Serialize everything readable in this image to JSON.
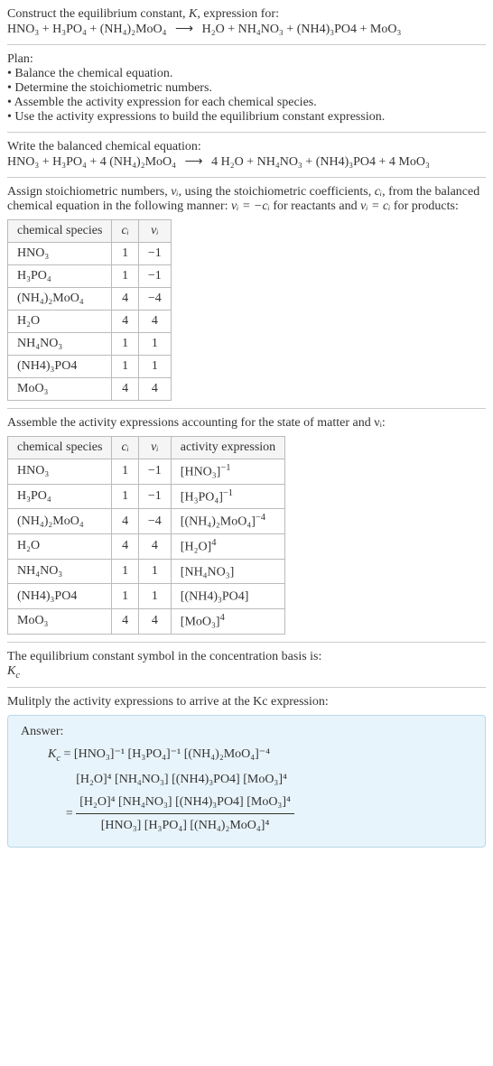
{
  "intro": {
    "line1": "Construct the equilibrium constant, ",
    "kvar": "K",
    "line1b": ", expression for:",
    "eq_lhs": "HNO₃ + H₃PO₄ + (NH₄)₂MoO₄",
    "arrow": "⟶",
    "eq_rhs": "H₂O + NH₄NO₃ + (NH4)₃PO4 + MoO₃"
  },
  "plan": {
    "heading": "Plan:",
    "items": [
      "Balance the chemical equation.",
      "Determine the stoichiometric numbers.",
      "Assemble the activity expression for each chemical species.",
      "Use the activity expressions to build the equilibrium constant expression."
    ]
  },
  "balanced": {
    "heading": "Write the balanced chemical equation:",
    "lhs": "HNO₃ + H₃PO₄ + 4 (NH₄)₂MoO₄",
    "arrow": "⟶",
    "rhs": "4 H₂O + NH₄NO₃ + (NH4)₃PO4 + 4 MoO₃"
  },
  "stoich": {
    "text1": "Assign stoichiometric numbers, ",
    "nu": "νᵢ",
    "text2": ", using the stoichiometric coefficients, ",
    "ci": "cᵢ",
    "text3": ", from the balanced chemical equation in the following manner: ",
    "rel1": "νᵢ = −cᵢ",
    "text4": " for reactants and ",
    "rel2": "νᵢ = cᵢ",
    "text5": " for products:"
  },
  "table1": {
    "headers": [
      "chemical species",
      "cᵢ",
      "νᵢ"
    ],
    "rows": [
      [
        "HNO₃",
        "1",
        "−1"
      ],
      [
        "H₃PO₄",
        "1",
        "−1"
      ],
      [
        "(NH₄)₂MoO₄",
        "4",
        "−4"
      ],
      [
        "H₂O",
        "4",
        "4"
      ],
      [
        "NH₄NO₃",
        "1",
        "1"
      ],
      [
        "(NH4)₃PO4",
        "1",
        "1"
      ],
      [
        "MoO₃",
        "4",
        "4"
      ]
    ]
  },
  "assemble": "Assemble the activity expressions accounting for the state of matter and νᵢ:",
  "table2": {
    "headers": [
      "chemical species",
      "cᵢ",
      "νᵢ",
      "activity expression"
    ],
    "rows": [
      {
        "s": "HNO₃",
        "c": "1",
        "n": "−1",
        "a": "[HNO₃]",
        "exp": "−1"
      },
      {
        "s": "H₃PO₄",
        "c": "1",
        "n": "−1",
        "a": "[H₃PO₄]",
        "exp": "−1"
      },
      {
        "s": "(NH₄)₂MoO₄",
        "c": "4",
        "n": "−4",
        "a": "[(NH₄)₂MoO₄]",
        "exp": "−4"
      },
      {
        "s": "H₂O",
        "c": "4",
        "n": "4",
        "a": "[H₂O]",
        "exp": "4"
      },
      {
        "s": "NH₄NO₃",
        "c": "1",
        "n": "1",
        "a": "[NH₄NO₃]",
        "exp": ""
      },
      {
        "s": "(NH4)₃PO4",
        "c": "1",
        "n": "1",
        "a": "[(NH4)₃PO4]",
        "exp": ""
      },
      {
        "s": "MoO₃",
        "c": "4",
        "n": "4",
        "a": "[MoO₃]",
        "exp": "4"
      }
    ]
  },
  "symbol": {
    "text": "The equilibrium constant symbol in the concentration basis is:",
    "kc": "K",
    "ksub": "c"
  },
  "multiply": "Mulitply the activity expressions to arrive at the Kc expression:",
  "answer": {
    "label": "Answer:",
    "kc": "Kc",
    "eq": " = ",
    "line1": "[HNO₃]⁻¹ [H₃PO₄]⁻¹ [(NH₄)₂MoO₄]⁻⁴",
    "line2": "[H₂O]⁴ [NH₄NO₃] [(NH4)₃PO4] [MoO₃]⁴",
    "frac_num": "[H₂O]⁴ [NH₄NO₃] [(NH4)₃PO4] [MoO₃]⁴",
    "frac_den": "[HNO₃] [H₃PO₄] [(NH₄)₂MoO₄]⁴"
  }
}
